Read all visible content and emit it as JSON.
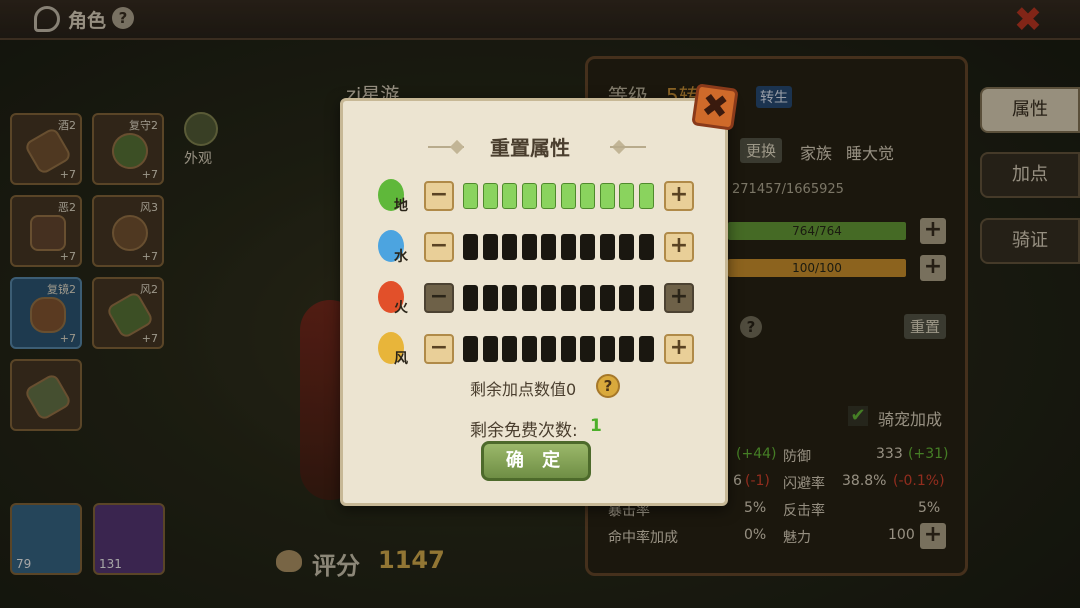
{
  "header": {
    "title": "角色",
    "help": "?"
  },
  "equipment": [
    {
      "tag": "酒2",
      "plus": "+7"
    },
    {
      "tag": "复守2",
      "plus": "+7"
    },
    {
      "tag": "恶2",
      "plus": "+7"
    },
    {
      "tag": "风3",
      "plus": "+7"
    },
    {
      "tag": "复镜2",
      "plus": "+7"
    },
    {
      "tag": "风2",
      "plus": "+7"
    },
    {
      "tag": "",
      "plus": ""
    }
  ],
  "outfit_label": "外观",
  "pets": [
    {
      "level": "79"
    },
    {
      "level": "131"
    }
  ],
  "score": {
    "label": "评分",
    "value": "1147"
  },
  "hero": {
    "name": "zi星游"
  },
  "info": {
    "level_label": "等级",
    "level_value": "5转",
    "rebirth": "转生",
    "replace": "更换",
    "family_label": "家族",
    "family_value": "睡大觉",
    "exp": "271457/1665925",
    "hp": "764/764",
    "mp": "100/100",
    "reset": "重置",
    "mount_label": "骑宠加成",
    "stats": [
      {
        "label": "",
        "value": "",
        "delta": "(+44)",
        "delta_color": "green"
      },
      {
        "label": "防御",
        "value": "333",
        "delta": "(+31)",
        "delta_color": "green"
      },
      {
        "label": "",
        "value": "6",
        "delta": "(-1)",
        "delta_color": "red"
      },
      {
        "label": "闪避率",
        "value": "38.8%",
        "delta": "(-0.1%)",
        "delta_color": "red"
      },
      {
        "label": "暴击率",
        "value": "5%",
        "delta": "",
        "delta_color": ""
      },
      {
        "label": "反击率",
        "value": "5%",
        "delta": "",
        "delta_color": ""
      },
      {
        "label": "命中率加成",
        "value": "0%",
        "delta": "",
        "delta_color": ""
      },
      {
        "label": "魅力",
        "value": "100",
        "delta": "",
        "delta_color": ""
      }
    ]
  },
  "tabs": [
    "属性",
    "加点",
    "骑证"
  ],
  "dialog": {
    "title": "重置属性",
    "elements": [
      {
        "label": "地",
        "filled": 10,
        "total": 10,
        "color": "#5fb83a",
        "fill": "#8ad35e",
        "minus_enabled": true,
        "plus_enabled": true
      },
      {
        "label": "水",
        "filled": 0,
        "total": 10,
        "color": "#4ca4e0",
        "fill": "#8ad35e",
        "minus_enabled": true,
        "plus_enabled": true
      },
      {
        "label": "火",
        "filled": 0,
        "total": 10,
        "color": "#e2502a",
        "fill": "#8ad35e",
        "minus_enabled": false,
        "plus_enabled": false
      },
      {
        "label": "风",
        "filled": 0,
        "total": 10,
        "color": "#e8b53a",
        "fill": "#8ad35e",
        "minus_enabled": true,
        "plus_enabled": true
      }
    ],
    "minus": "−",
    "plus": "+",
    "remaining_points_label": "剩余加点数值0",
    "remaining_free_label": "剩余免费次数:",
    "remaining_free_value": "1",
    "confirm": "确 定",
    "help": "?",
    "close": "✖"
  }
}
